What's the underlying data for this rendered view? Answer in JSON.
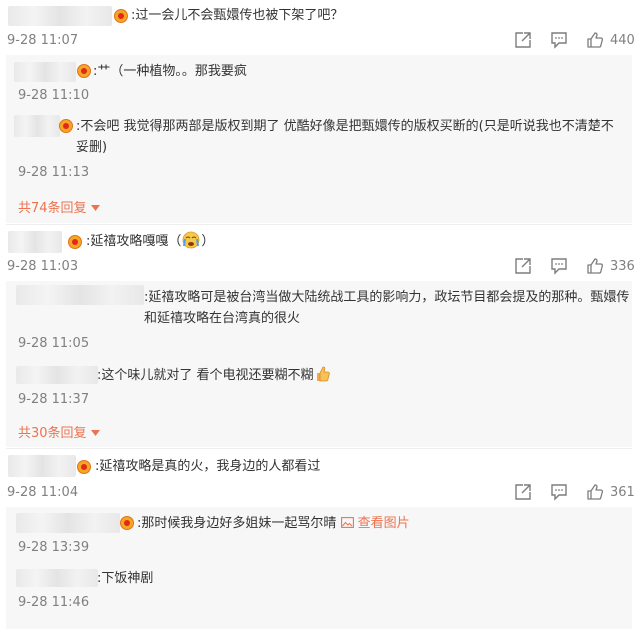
{
  "comments": [
    {
      "text": ":过一会儿不会甄嬛传也被下架了吧？",
      "time": "9-28 11:07",
      "likes": "440",
      "replies": [
        {
          "text": ":艹（一种植物。。那我要疯",
          "time": "9-28 11:10"
        },
        {
          "text": ":不会吧 我觉得那两部是版权到期了 优酷好像是把甄嬛传的版权买断的(只是听说我也不清楚不妥删)",
          "time": "9-28 11:13"
        }
      ],
      "more": "共74条回复"
    },
    {
      "text": ":延禧攻略嘎嘎（",
      "text_end": "）",
      "time": "9-28 11:03",
      "likes": "336",
      "replies": [
        {
          "text": ":延禧攻略可是被台湾当做大陆统战工具的影响力，政坛节目都会提及的那种。甄嬛传和延禧攻略在台湾真的很火",
          "time": "9-28 11:05"
        },
        {
          "text": ":这个味儿就对了 看个电视还要糊不糊",
          "time": "9-28 11:37"
        }
      ],
      "more": "共30条回复"
    },
    {
      "text": ":延禧攻略是真的火，我身边的人都看过",
      "time": "9-28 11:04",
      "likes": "361",
      "replies": [
        {
          "text": ":那时候我身边好多姐妹一起骂尔晴",
          "link": "查看图片",
          "time": "9-28 13:39"
        },
        {
          "text": ":下饭神剧",
          "time": "9-28 11:46"
        }
      ]
    }
  ],
  "icons": [
    "share-icon",
    "comment-icon",
    "like-icon",
    "thumbs-up-emoji-icon",
    "crying-emoji-icon",
    "image-icon",
    "triangle-down-icon"
  ],
  "colors": {
    "accent": "#eb7350",
    "muted": "#808080",
    "reply_bg": "#f7f7f7",
    "badge": "#f5a623"
  }
}
